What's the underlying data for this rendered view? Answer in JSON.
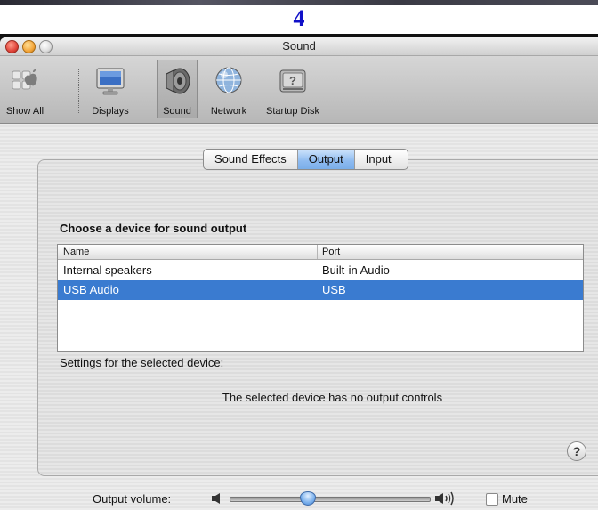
{
  "step_number": "4",
  "window": {
    "title": "Sound"
  },
  "toolbar": {
    "items": [
      {
        "label": "Show All",
        "icon": "apple-icon"
      },
      {
        "label": "Displays",
        "icon": "display-icon"
      },
      {
        "label": "Sound",
        "icon": "speaker-icon",
        "selected": true
      },
      {
        "label": "Network",
        "icon": "network-globe-icon"
      },
      {
        "label": "Startup Disk",
        "icon": "hard-disk-icon"
      }
    ]
  },
  "tabs": [
    {
      "label": "Sound Effects",
      "active": false
    },
    {
      "label": "Output",
      "active": true
    },
    {
      "label": "Input",
      "active": false
    }
  ],
  "output": {
    "heading": "Choose a device for sound output",
    "columns": [
      "Name",
      "Port"
    ],
    "devices": [
      {
        "name": "Internal speakers",
        "port": "Built-in Audio",
        "selected": false
      },
      {
        "name": "USB Audio",
        "port": "USB",
        "selected": true
      }
    ],
    "settings_label": "Settings for the selected device:",
    "no_controls_message": "The selected device has no output controls"
  },
  "help_button": "?",
  "volume": {
    "label": "Output volume:",
    "level": 0.39,
    "mute_label": "Mute",
    "muted": false
  },
  "colors": {
    "selection": "#3a7bd0",
    "step_number": "#1010c8",
    "active_tab": "#8dbaf0"
  }
}
